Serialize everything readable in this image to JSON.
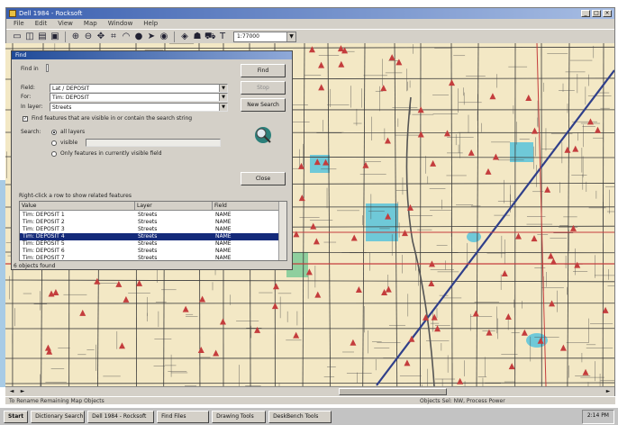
{
  "window": {
    "title": "Dell 1984 - Rocksoft",
    "menu": [
      "File",
      "Edit",
      "View",
      "Map",
      "Window",
      "Help"
    ],
    "zoom_value": "1:77000"
  },
  "toolbar_icons": [
    "new-icon",
    "open-icon",
    "print-icon",
    "save-icon",
    "zoom-in-icon",
    "zoom-out-icon",
    "pan-icon",
    "select-icon",
    "globe-icon",
    "arrow-icon",
    "locate-icon",
    "info-icon",
    "route-icon",
    "label-icon"
  ],
  "dialog": {
    "title": "Find",
    "find_in_label": "Find in",
    "field_label": "Field:",
    "field_value": "Lat / DEPOSIT",
    "for_label": "For:",
    "for_value": "Tim: DEPOSIT",
    "in_layer_label": "In layer:",
    "in_layer_value": "Streets",
    "checkbox_label": "Find features that are visible in or contain the search string",
    "search_label": "Search:",
    "radio_all": "all layers",
    "radio_visible": "visible",
    "radio_visible_value": "",
    "radio_selected": "Only features in currently visible field",
    "buttons": {
      "find": "Find",
      "stop": "Stop",
      "new_search": "New Search",
      "close": "Close"
    },
    "results_hint": "Right-click a row to show related features",
    "columns": [
      "Value",
      "Layer",
      "Field"
    ],
    "rows": [
      {
        "value": "Tim: DEPOSIT 1",
        "layer": "Streets",
        "field": "NAME"
      },
      {
        "value": "Tim: DEPOSIT 2",
        "layer": "Streets",
        "field": "NAME"
      },
      {
        "value": "Tim: DEPOSIT 3",
        "layer": "Streets",
        "field": "NAME"
      },
      {
        "value": "Tim: DEPOSIT 4",
        "layer": "Streets",
        "field": "NAME"
      },
      {
        "value": "Tim: DEPOSIT 5",
        "layer": "Streets",
        "field": "NAME"
      },
      {
        "value": "Tim: DEPOSIT 6",
        "layer": "Streets",
        "field": "NAME"
      },
      {
        "value": "Tim: DEPOSIT 7",
        "layer": "Streets",
        "field": "NAME"
      }
    ],
    "selected_row": 3,
    "status": "6 objects found"
  },
  "statusbar": {
    "left": "To Rename Remaining Map Objects",
    "right": "Objects Sel: NW, Process Power"
  },
  "taskbar": {
    "start": "Start",
    "tasks": [
      "Dictionary Search",
      "Dell 1984 - Rocksoft",
      "Find Files",
      "Drawing Tools",
      "DeskBench Tools"
    ],
    "clock": "2:14 PM"
  },
  "colors": {
    "map_bg": "#f3e8c5",
    "road": "#3a3a3a",
    "highway": "#c43d3d",
    "water": "#6fc9d8",
    "park": "#8fcf9e",
    "selection": "#142a7a"
  }
}
